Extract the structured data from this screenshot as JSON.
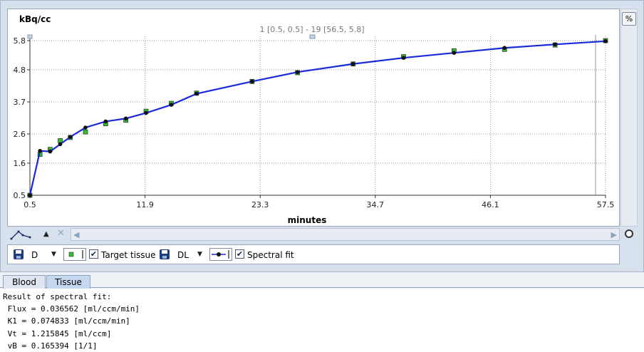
{
  "chart_data": {
    "type": "line",
    "ylabel": "kBq/cc",
    "xlabel": "minutes",
    "xticks": [
      "0.5",
      "11.9",
      "23.3",
      "34.7",
      "46.1",
      "57.5"
    ],
    "yticks": [
      "0.5",
      "1.6",
      "2.6",
      "3.7",
      "4.8",
      "5.8"
    ],
    "xlim": [
      0.5,
      57.5
    ],
    "ylim": [
      0.5,
      5.8
    ],
    "range_label": "1 [0.5, 0.5] - 19 [56.5, 5.8]",
    "grid": true,
    "series": [
      {
        "name": "Target tissue",
        "color": "#2fbf2f",
        "marker": "square",
        "x": [
          0.5,
          1.5,
          2.5,
          3.5,
          4.5,
          6.0,
          8.0,
          10.0,
          12.0,
          14.5,
          17.0,
          22.5,
          27.0,
          32.5,
          37.5,
          42.5,
          47.5,
          52.5,
          57.5
        ],
        "y": [
          0.5,
          1.9,
          2.07,
          2.37,
          2.48,
          2.67,
          2.95,
          3.07,
          3.38,
          3.65,
          4.0,
          4.4,
          4.7,
          5.0,
          5.25,
          5.45,
          5.5,
          5.65,
          5.8
        ]
      },
      {
        "name": "Spectral fit",
        "color": "#1a2ad8",
        "marker": "circle",
        "x": [
          0.5,
          1.5,
          2.5,
          3.5,
          4.5,
          6.0,
          8.0,
          10.0,
          12.0,
          14.5,
          17.0,
          22.5,
          27.0,
          32.5,
          37.5,
          42.5,
          47.5,
          52.5,
          57.5
        ],
        "y": [
          0.5,
          2.02,
          2.0,
          2.25,
          2.5,
          2.82,
          3.03,
          3.13,
          3.32,
          3.6,
          3.98,
          4.4,
          4.72,
          5.0,
          5.21,
          5.38,
          5.55,
          5.67,
          5.78
        ]
      }
    ]
  },
  "legend": {
    "d_label": "D",
    "target_label": "Target tissue",
    "dl_label": "DL",
    "fit_label": "Spectral fit"
  },
  "buttons": {
    "percent": "%"
  },
  "tabs": {
    "blood": "Blood",
    "tissue": "Tissue"
  },
  "result": {
    "title": "Result of spectral fit:",
    "lines": [
      " Flux = 0.036562 [ml/ccm/min]",
      " K1 = 0.074833 [ml/ccm/min]",
      " Vt = 1.215845 [ml/ccm]",
      " vB = 0.165394 [1/1]"
    ]
  }
}
